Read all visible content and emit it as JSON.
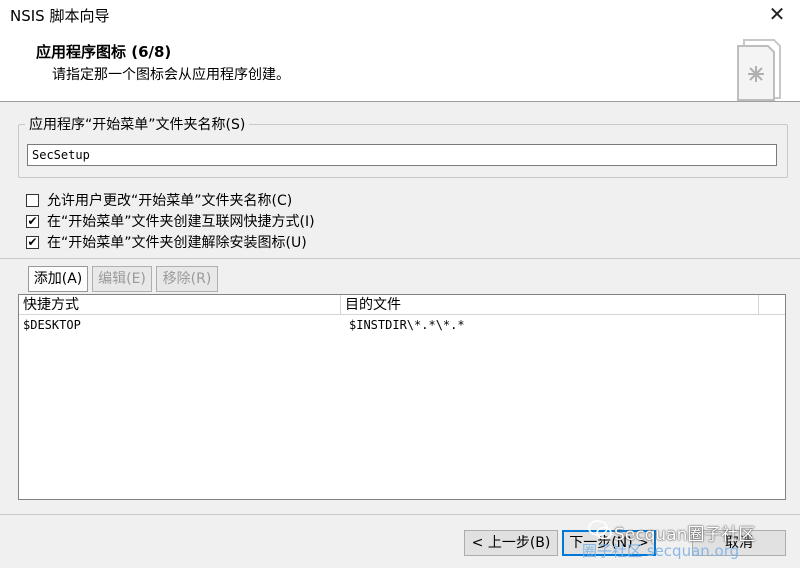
{
  "window": {
    "title": "NSIS 脚本向导",
    "close_glyph": "✕"
  },
  "header": {
    "title": "应用程序图标 (6/8)",
    "subtitle": "请指定那一个图标会从应用程序创建。"
  },
  "start_menu_group": {
    "label": "应用程序“开始菜单”文件夹名称(S)",
    "value": "SecSetup"
  },
  "options": [
    {
      "label": "允许用户更改“开始菜单”文件夹名称(C)",
      "checked": false
    },
    {
      "label": "在“开始菜单”文件夹创建互联网快捷方式(I)",
      "checked": true
    },
    {
      "label": "在“开始菜单”文件夹创建解除安装图标(U)",
      "checked": true
    }
  ],
  "list_toolbar": {
    "add": "添加(A)",
    "edit": "编辑(E)",
    "remove": "移除(R)"
  },
  "shortcut_list": {
    "columns": [
      "快捷方式",
      "目的文件"
    ],
    "rows": [
      [
        "$DESKTOP",
        "$INSTDIR\\*.*\\*.*"
      ]
    ]
  },
  "footer": {
    "back": "< 上一步(B)",
    "next": "下一步(N) >",
    "cancel": "取消"
  },
  "watermark": {
    "line1": "Secquan圈子社区",
    "line2": "圈子社区 secquan.org"
  },
  "check_glyph": "✔"
}
